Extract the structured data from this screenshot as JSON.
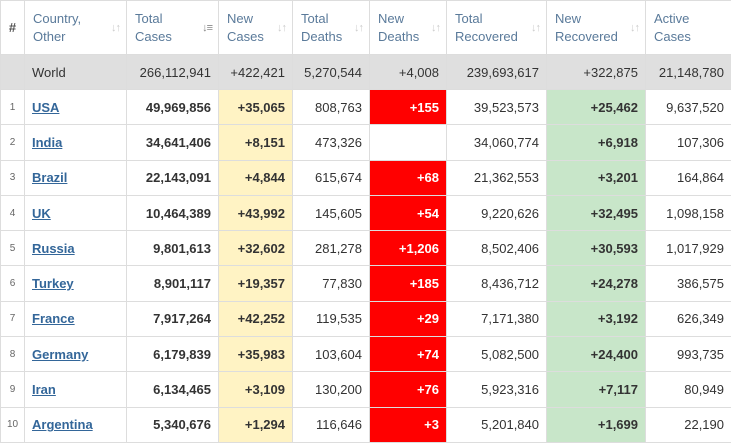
{
  "colors": {
    "header_text": "#ffffff",
    "world_row_bg": "#dfdfdf",
    "new_cases_bg": "#fff3c4",
    "new_deaths_bg": "#ff0000",
    "new_recovered_bg": "#c8e6c9",
    "link_color": "#336699"
  },
  "headers": {
    "hash": "#",
    "country": [
      "Country,",
      "Other"
    ],
    "total_cases": [
      "Total",
      "Cases"
    ],
    "new_cases": [
      "New",
      "Cases"
    ],
    "total_deaths": [
      "Total",
      "Deaths"
    ],
    "new_deaths": [
      "New",
      "Deaths"
    ],
    "total_recovered": [
      "Total",
      "Recovered"
    ],
    "new_recovered": [
      "New",
      "Recovered"
    ],
    "active_cases": [
      "Active",
      "Cases"
    ]
  },
  "world": {
    "country": "World",
    "total_cases": "266,112,941",
    "new_cases": "+422,421",
    "total_deaths": "5,270,544",
    "new_deaths": "+4,008",
    "total_recovered": "239,693,617",
    "new_recovered": "+322,875",
    "active_cases": "21,148,780"
  },
  "rows": [
    {
      "rank": "1",
      "country": "USA",
      "total_cases": "49,969,856",
      "new_cases": "+35,065",
      "total_deaths": "808,763",
      "new_deaths": "+155",
      "total_recovered": "39,523,573",
      "new_recovered": "+25,462",
      "active_cases": "9,637,520"
    },
    {
      "rank": "2",
      "country": "India",
      "total_cases": "34,641,406",
      "new_cases": "+8,151",
      "total_deaths": "473,326",
      "new_deaths": "",
      "total_recovered": "34,060,774",
      "new_recovered": "+6,918",
      "active_cases": "107,306"
    },
    {
      "rank": "3",
      "country": "Brazil",
      "total_cases": "22,143,091",
      "new_cases": "+4,844",
      "total_deaths": "615,674",
      "new_deaths": "+68",
      "total_recovered": "21,362,553",
      "new_recovered": "+3,201",
      "active_cases": "164,864"
    },
    {
      "rank": "4",
      "country": "UK",
      "total_cases": "10,464,389",
      "new_cases": "+43,992",
      "total_deaths": "145,605",
      "new_deaths": "+54",
      "total_recovered": "9,220,626",
      "new_recovered": "+32,495",
      "active_cases": "1,098,158"
    },
    {
      "rank": "5",
      "country": "Russia",
      "total_cases": "9,801,613",
      "new_cases": "+32,602",
      "total_deaths": "281,278",
      "new_deaths": "+1,206",
      "total_recovered": "8,502,406",
      "new_recovered": "+30,593",
      "active_cases": "1,017,929"
    },
    {
      "rank": "6",
      "country": "Turkey",
      "total_cases": "8,901,117",
      "new_cases": "+19,357",
      "total_deaths": "77,830",
      "new_deaths": "+185",
      "total_recovered": "8,436,712",
      "new_recovered": "+24,278",
      "active_cases": "386,575"
    },
    {
      "rank": "7",
      "country": "France",
      "total_cases": "7,917,264",
      "new_cases": "+42,252",
      "total_deaths": "119,535",
      "new_deaths": "+29",
      "total_recovered": "7,171,380",
      "new_recovered": "+3,192",
      "active_cases": "626,349"
    },
    {
      "rank": "8",
      "country": "Germany",
      "total_cases": "6,179,839",
      "new_cases": "+35,983",
      "total_deaths": "103,604",
      "new_deaths": "+74",
      "total_recovered": "5,082,500",
      "new_recovered": "+24,400",
      "active_cases": "993,735"
    },
    {
      "rank": "9",
      "country": "Iran",
      "total_cases": "6,134,465",
      "new_cases": "+3,109",
      "total_deaths": "130,200",
      "new_deaths": "+76",
      "total_recovered": "5,923,316",
      "new_recovered": "+7,117",
      "active_cases": "80,949"
    },
    {
      "rank": "10",
      "country": "Argentina",
      "total_cases": "5,340,676",
      "new_cases": "+1,294",
      "total_deaths": "116,646",
      "new_deaths": "+3",
      "total_recovered": "5,201,840",
      "new_recovered": "+1,699",
      "active_cases": "22,190"
    }
  ]
}
